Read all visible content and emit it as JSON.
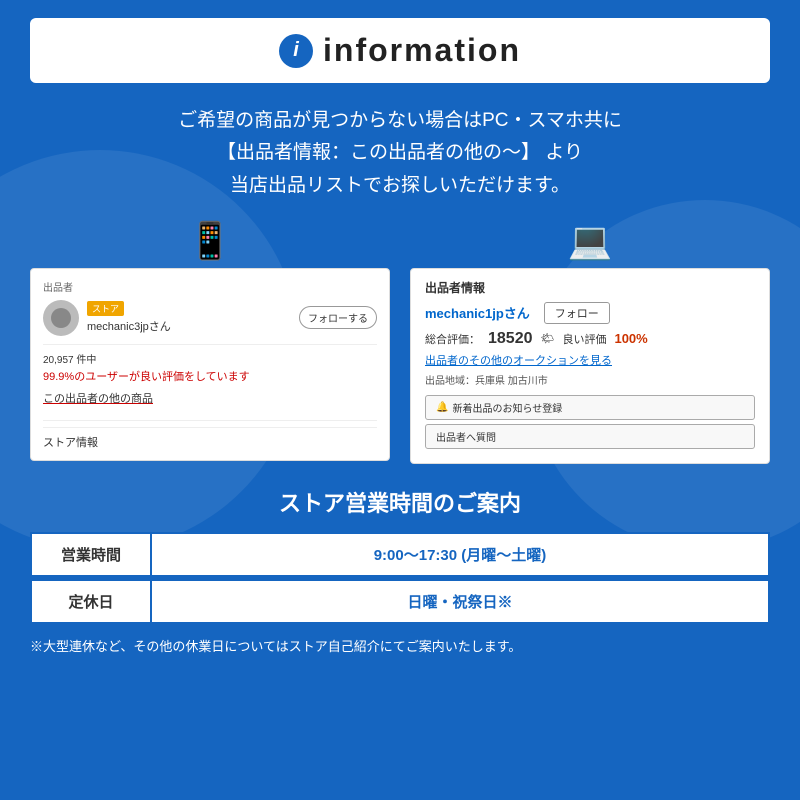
{
  "background": {
    "color": "#1565c0"
  },
  "header": {
    "icon_char": "i",
    "title": "information"
  },
  "description": {
    "line1": "ご希望の商品が見つからない場合はPC・スマホ共に",
    "line2": "【出品者情報：この出品者の他の～】 より",
    "line3": "当店出品リストでお探しいただけます。"
  },
  "mobile_screenshot": {
    "section_label": "出品者",
    "store_badge": "ストア",
    "username": "mechanic3jpさん",
    "follow_label": "フォローする",
    "stats": "20,957 件中",
    "positive_rate": "99.9%のユーザーが良い評価をしています",
    "link_text": "この出品者の他の商品",
    "store_info": "ストア情報"
  },
  "pc_screenshot": {
    "section_label": "出品者情報",
    "username": "mechanic1jpさん",
    "follow_label": "フォロー",
    "total_label": "総合評価：",
    "total_num": "18520",
    "good_label": "良い評価",
    "good_pct": "100%",
    "auction_link": "出品者のその他のオークションを見る",
    "location": "出品地域：兵庫県 加古川市",
    "notify_btn": "新着出品のお知らせ登録",
    "question_btn": "出品者へ質問"
  },
  "store_hours": {
    "title": "ストア営業時間のご案内",
    "rows": [
      {
        "label": "営業時間",
        "value": "9:00～17:30 (月曜～土曜)"
      },
      {
        "label": "定休日",
        "value": "日曜・祝祭日※"
      }
    ],
    "footnote": "※大型連休など、その他の休業日についてはストア自己紹介にてご案内いたします。"
  },
  "icons": {
    "smartphone": "📱",
    "pc": "💻",
    "bell": "🔔"
  }
}
